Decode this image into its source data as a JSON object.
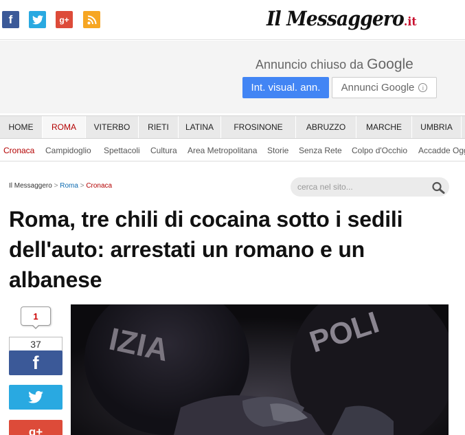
{
  "header": {
    "social": [
      {
        "name": "facebook",
        "glyph": "f"
      },
      {
        "name": "twitter",
        "glyph": "twitter-bird-icon"
      },
      {
        "name": "google-plus",
        "glyph": "g+"
      },
      {
        "name": "rss",
        "glyph": "rss-icon"
      }
    ],
    "logo_text": "Il Messaggero",
    "logo_suffix": ".it"
  },
  "ad": {
    "closed_text": "Annuncio chiuso da",
    "closed_brand": "Google",
    "button_primary": "Int. visual. ann.",
    "button_secondary": "Annunci Google"
  },
  "nav": {
    "items": [
      {
        "label": "HOME"
      },
      {
        "label": "ROMA",
        "active": true
      },
      {
        "label": "VITERBO"
      },
      {
        "label": "RIETI"
      },
      {
        "label": "LATINA"
      },
      {
        "label": "FROSINONE"
      },
      {
        "label": "ABRUZZO"
      },
      {
        "label": "MARCHE"
      },
      {
        "label": "UMBRIA"
      }
    ]
  },
  "subnav": {
    "items": [
      {
        "label": "Cronaca",
        "active": true
      },
      {
        "label": "Campidoglio"
      },
      {
        "label": "Spettacoli"
      },
      {
        "label": "Cultura"
      },
      {
        "label": "Area Metropolitana"
      },
      {
        "label": "Storie"
      },
      {
        "label": "Senza Rete"
      },
      {
        "label": "Colpo d'Occhio"
      },
      {
        "label": "Accadde Oggi"
      }
    ]
  },
  "breadcrumb": {
    "home": "Il Messaggero",
    "sep": ">",
    "section": "Roma",
    "current": "Cronaca"
  },
  "search": {
    "placeholder": "cerca nel sito..."
  },
  "article": {
    "headline": "Roma, tre chili di cocaina sotto i sedili dell'auto: arrestati un romano e un albanese",
    "comment_count": "1",
    "facebook_count": "37",
    "share_fb": "f",
    "share_gp": "g+",
    "photo_text_left": "IZIA",
    "photo_text_right": "POLI"
  },
  "colors": {
    "facebook": "#3b5998",
    "twitter": "#29a9e1",
    "google_plus": "#dd4b39",
    "rss": "#f6a623",
    "accent_red": "#b30000",
    "google_blue": "#4285f4"
  }
}
